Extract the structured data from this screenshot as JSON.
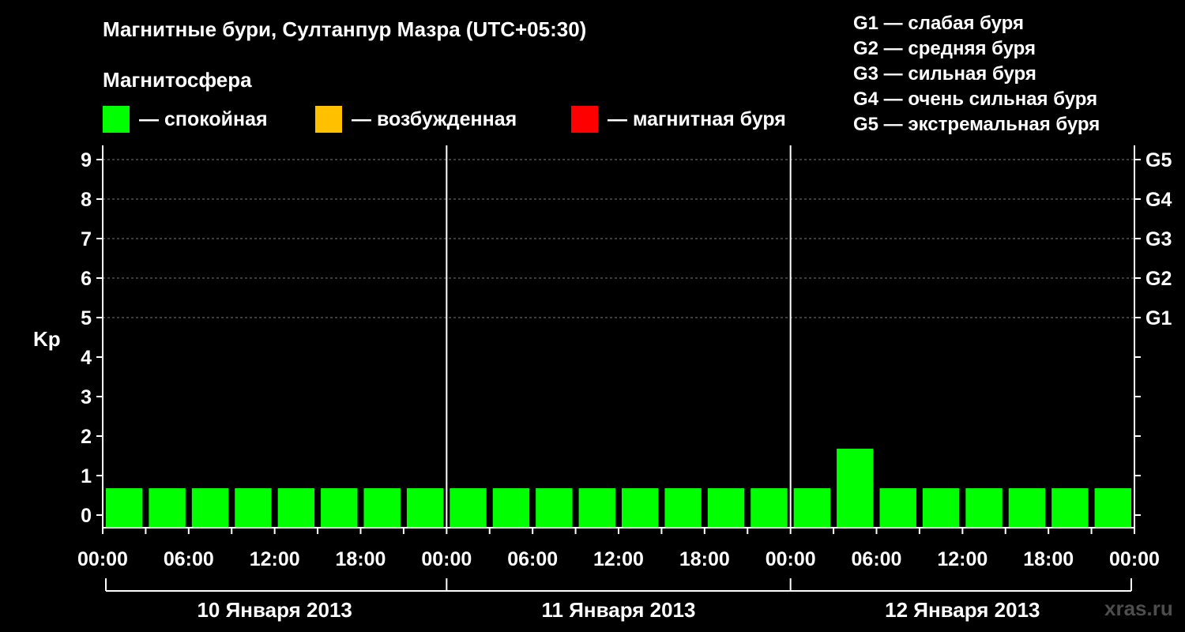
{
  "header": {
    "title": "Магнитные бури, Султанпур Мазра (UTC+05:30)",
    "magnetosphere_label": "Магнитосфера"
  },
  "legend": [
    {
      "label": "— спокойная",
      "color": "#00ff00"
    },
    {
      "label": "— возбужденная",
      "color": "#ffc000"
    },
    {
      "label": "— магнитная буря",
      "color": "#ff0000"
    }
  ],
  "storm_levels": [
    "G1 — слабая буря",
    "G2 — средняя буря",
    "G3 — сильная буря",
    "G4 — очень сильная буря",
    "G5 — экстремальная буря"
  ],
  "watermark": "xras.ru",
  "chart_data": {
    "type": "bar",
    "ylabel": "Kp",
    "ylim": [
      0,
      9
    ],
    "y_ticks": [
      "0",
      "1",
      "2",
      "3",
      "4",
      "5",
      "6",
      "7",
      "8",
      "9"
    ],
    "right_ticks": [
      {
        "level": 5,
        "label": "G1"
      },
      {
        "level": 6,
        "label": "G2"
      },
      {
        "level": 7,
        "label": "G3"
      },
      {
        "level": 8,
        "label": "G4"
      },
      {
        "level": 9,
        "label": "G5"
      }
    ],
    "x_tick_labels": [
      "00:00",
      "06:00",
      "12:00",
      "18:00",
      "00:00",
      "06:00",
      "12:00",
      "18:00",
      "00:00",
      "06:00",
      "12:00",
      "18:00",
      "00:00"
    ],
    "days": [
      "10 Января 2013",
      "11 Января 2013",
      "12 Января 2013"
    ],
    "interval_hours": 3,
    "colors": {
      "quiet": "#00ff00",
      "active": "#ffc000",
      "storm": "#ff0000"
    },
    "kp_values": [
      1,
      1,
      1,
      0,
      0,
      1,
      0,
      1,
      1,
      0,
      0,
      0,
      0,
      1,
      1,
      0,
      1,
      2,
      1,
      1,
      0,
      1,
      1,
      1
    ]
  }
}
